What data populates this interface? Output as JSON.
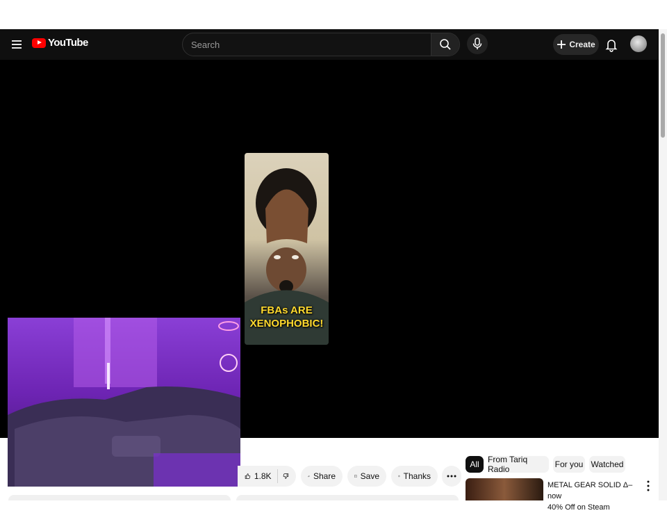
{
  "masthead": {
    "logo_text": "YouTube",
    "search_placeholder": "Search",
    "create_label": "Create"
  },
  "player": {
    "overlay_line1": "FBAs ARE",
    "overlay_line2": "XENOPHOBIC!"
  },
  "actions": {
    "like_count": "1.8K",
    "share_label": "Share",
    "save_label": "Save",
    "thanks_label": "Thanks"
  },
  "chips": [
    "All",
    "From Tariq Radio",
    "For you",
    "Watched"
  ],
  "recommendation": {
    "title_line1": "METAL GEAR SOLID Δ– now",
    "title_line2": "40% Off on Steam"
  },
  "colors": {
    "masthead_bg": "#0f0f0f",
    "brand_red": "#ff0000",
    "overlay_text": "#ffd92e",
    "webcam_purple": "#8a3fd6"
  }
}
